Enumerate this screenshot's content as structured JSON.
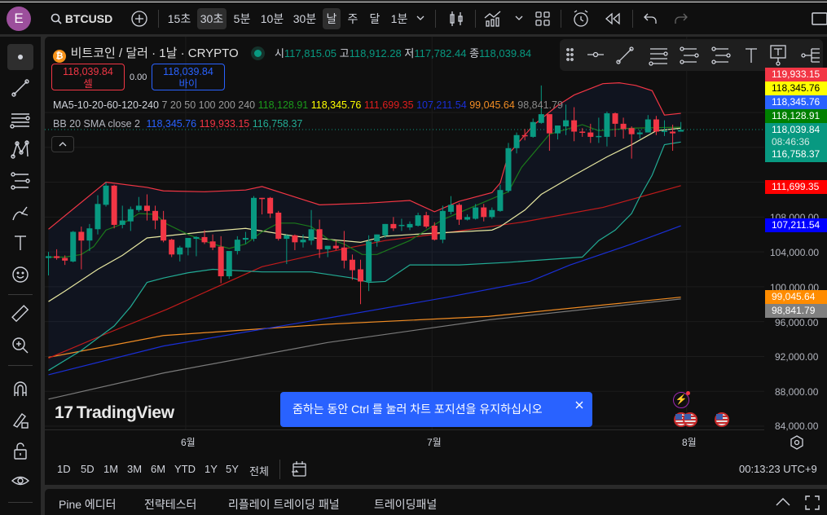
{
  "topbar": {
    "avatar": "E",
    "symbol": "BTCUSD",
    "intervals": [
      "15초",
      "30초",
      "5분",
      "10분",
      "30분",
      "날",
      "주",
      "달",
      "1분"
    ],
    "selected_intervals": [
      "30초",
      "날"
    ]
  },
  "legend": {
    "title": "비트코인 / 달러 · 1날 · CRYPTO",
    "o_label": "시",
    "o": "117,815.05",
    "h_label": "고",
    "h": "118,912.28",
    "l_label": "저",
    "l": "117,782.44",
    "c_label": "종",
    "c": "118,039.84",
    "sell_price": "118,039.84",
    "sell_label": "셀",
    "spread": "0.00",
    "buy_price": "118,039.84",
    "buy_label": "바이",
    "ma_name": "MA5-10-20-60-120-240",
    "ma_params": "7 20 50 100 200 240",
    "ma_values": [
      "118,128.91",
      "118,345.76",
      "111,699.35",
      "107,211.54",
      "99,045.64",
      "98,841.79"
    ],
    "bb_name": "BB 20 SMA close 2",
    "bb_values": [
      "118,345.76",
      "119,933.15",
      "116,758.37"
    ]
  },
  "price_labels": [
    {
      "text": "119,933.15",
      "color": "#f23645"
    },
    {
      "text": "118,345.76",
      "color": "#ffff00"
    },
    {
      "text": "118,345.76",
      "color": "#2962ff"
    },
    {
      "text": "118,128.91",
      "color": "#008000"
    },
    {
      "text": "118,039.84",
      "color": "#089981"
    },
    {
      "text": "08:46:36",
      "color": "#089981"
    },
    {
      "text": "116,758.37",
      "color": "#089981"
    },
    {
      "text": "111,699.35",
      "color": "#ff0000"
    },
    {
      "text": "107,211.54",
      "color": "#0000ff"
    },
    {
      "text": "99,045.64",
      "color": "#ff8c00"
    },
    {
      "text": "98,841.79",
      "color": "#808080"
    }
  ],
  "price_ticks": [
    "108,000.00",
    "104,000.00",
    "100,000.00",
    "96,000.00",
    "92,000.00",
    "88,000.00",
    "84,000.00"
  ],
  "time_ticks": [
    "6월",
    "7월",
    "8월"
  ],
  "toast": {
    "text": "줌하는 동안 Ctrl 를 눌러 차트 포지션을 유지하십시오"
  },
  "logo": "TradingView",
  "ranges": [
    "1D",
    "5D",
    "1M",
    "3M",
    "6M",
    "YTD",
    "1Y",
    "5Y",
    "전체"
  ],
  "clock": "00:13:23 UTC+9",
  "panel_tabs": [
    "Pine 에디터",
    "전략테스터",
    "리플레이 트레이딩 패널",
    "트레이딩패널"
  ],
  "colors": {
    "up": "#089981",
    "down": "#f23645",
    "bb_upper": "#f23645",
    "bb_lower": "#22ab94",
    "bb_basis": "#e6e6a0",
    "ma_short": "#1b7a1b",
    "ma60": "#c21b1b",
    "ma120": "#1a2fd6",
    "ma200": "#f08c24",
    "ma240": "#7a7a7a"
  },
  "chart_data": {
    "type": "candlestick",
    "unit": "thousand USD",
    "ylim": [
      84,
      124
    ],
    "x_ticks": {
      "6월": 17,
      "7월": 47,
      "8월": 78
    },
    "candles": [
      [
        103.3,
        104.0,
        101.3,
        103.5
      ],
      [
        103.5,
        104.3,
        103.1,
        103.3
      ],
      [
        103.3,
        103.6,
        102.5,
        103.0
      ],
      [
        102.9,
        106.4,
        102.8,
        106.3
      ],
      [
        106.3,
        106.9,
        102.0,
        105.3
      ],
      [
        105.3,
        107.2,
        104.1,
        106.7
      ],
      [
        106.6,
        110.5,
        106.0,
        109.5
      ],
      [
        109.4,
        112.0,
        109.2,
        111.6
      ],
      [
        111.6,
        111.7,
        106.7,
        107.1
      ],
      [
        107.1,
        109.3,
        106.7,
        107.6
      ],
      [
        107.5,
        109.2,
        106.4,
        108.9
      ],
      [
        108.8,
        110.3,
        108.6,
        109.3
      ],
      [
        109.3,
        110.6,
        107.6,
        108.7
      ],
      [
        108.7,
        109.3,
        106.6,
        107.6
      ],
      [
        107.7,
        108.7,
        105.1,
        105.3
      ],
      [
        105.4,
        105.5,
        103.4,
        103.7
      ],
      [
        103.7,
        104.7,
        102.9,
        104.5
      ],
      [
        104.5,
        105.6,
        103.6,
        105.6
      ],
      [
        105.5,
        105.8,
        103.5,
        105.7
      ],
      [
        105.7,
        106.5,
        104.9,
        105.1
      ],
      [
        105.2,
        106.0,
        104.2,
        104.5
      ],
      [
        104.6,
        105.8,
        100.4,
        101.2
      ],
      [
        101.2,
        104.1,
        100.9,
        104.1
      ],
      [
        104.1,
        105.8,
        103.7,
        105.4
      ],
      [
        105.4,
        106.3,
        104.9,
        105.6
      ],
      [
        105.5,
        110.4,
        105.2,
        110.2
      ],
      [
        110.2,
        110.2,
        108.3,
        110.1
      ],
      [
        110.2,
        110.3,
        107.9,
        108.4
      ],
      [
        108.5,
        108.7,
        105.3,
        105.5
      ],
      [
        105.5,
        106.0,
        102.6,
        105.9
      ],
      [
        105.9,
        106.0,
        104.2,
        105.1
      ],
      [
        105.1,
        106.0,
        104.5,
        105.4
      ],
      [
        105.3,
        108.8,
        104.8,
        106.6
      ],
      [
        106.6,
        107.7,
        103.3,
        104.3
      ],
      [
        104.3,
        104.7,
        103.4,
        104.7
      ],
      [
        104.7,
        105.3,
        104.2,
        104.4
      ],
      [
        104.5,
        106.4,
        102.1,
        103.0
      ],
      [
        103.1,
        103.7,
        100.8,
        101.9
      ],
      [
        102.0,
        103.1,
        98.0,
        100.6
      ],
      [
        100.6,
        105.9,
        99.5,
        105.2
      ],
      [
        105.2,
        106.0,
        104.6,
        106.0
      ],
      [
        105.9,
        107.2,
        105.6,
        107.2
      ],
      [
        107.2,
        108.0,
        106.4,
        106.7
      ],
      [
        107.0,
        107.8,
        106.4,
        107.1
      ],
      [
        106.8,
        107.5,
        106.5,
        107.2
      ],
      [
        107.0,
        108.5,
        106.9,
        108.2
      ],
      [
        108.2,
        108.6,
        106.7,
        106.9
      ],
      [
        107.0,
        107.4,
        105.3,
        105.4
      ],
      [
        105.4,
        109.3,
        105.0,
        108.7
      ],
      [
        108.6,
        110.4,
        108.3,
        109.4
      ],
      [
        109.4,
        109.6,
        107.1,
        107.7
      ],
      [
        107.7,
        108.3,
        107.6,
        108.0
      ],
      [
        107.8,
        109.5,
        107.7,
        109.1
      ],
      [
        109.1,
        109.5,
        107.5,
        108.0
      ],
      [
        108.0,
        109.1,
        107.8,
        108.8
      ],
      [
        108.7,
        111.7,
        108.6,
        111.1
      ],
      [
        111.0,
        116.5,
        110.8,
        115.9
      ],
      [
        115.9,
        117.7,
        115.3,
        117.4
      ],
      [
        117.4,
        118.1,
        116.8,
        117.3
      ],
      [
        117.2,
        119.3,
        117.1,
        118.9
      ],
      [
        118.8,
        123.1,
        118.7,
        119.8
      ],
      [
        119.8,
        119.8,
        115.6,
        117.6
      ],
      [
        117.6,
        118.5,
        116.9,
        118.5
      ],
      [
        118.4,
        120.9,
        117.4,
        119.1
      ],
      [
        119.1,
        120.6,
        116.7,
        117.8
      ],
      [
        117.8,
        118.2,
        117.2,
        117.7
      ],
      [
        117.7,
        118.7,
        116.5,
        117.2
      ],
      [
        117.2,
        119.4,
        116.5,
        117.3
      ],
      [
        117.2,
        120.1,
        116.1,
        119.9
      ],
      [
        119.9,
        120.0,
        117.2,
        118.7
      ],
      [
        118.7,
        119.4,
        117.0,
        118.1
      ],
      [
        118.2,
        118.4,
        114.7,
        117.5
      ],
      [
        117.5,
        118.0,
        117.0,
        117.7
      ],
      [
        117.7,
        119.7,
        117.7,
        119.2
      ],
      [
        119.2,
        119.6,
        117.4,
        117.8
      ],
      [
        117.8,
        119.1,
        117.3,
        117.9
      ],
      [
        117.8,
        118.6,
        115.6,
        117.6
      ],
      [
        117.8,
        118.9,
        117.8,
        118.0
      ]
    ],
    "lines": {
      "bb_upper": [
        [
          0,
          106.6
        ],
        [
          7,
          112.0
        ],
        [
          12,
          111.4
        ],
        [
          14,
          111.0
        ],
        [
          19,
          110.9
        ],
        [
          24,
          111.1
        ],
        [
          26,
          111.5
        ],
        [
          28,
          110.9
        ],
        [
          33,
          109.4
        ],
        [
          39,
          109.6
        ],
        [
          44,
          109.9
        ],
        [
          47,
          108.6
        ],
        [
          50,
          109.8
        ],
        [
          54,
          110.8
        ],
        [
          55,
          111.9
        ],
        [
          56,
          115.2
        ],
        [
          59,
          118.5
        ],
        [
          62,
          120.8
        ],
        [
          64,
          122.0
        ],
        [
          67.5,
          123.3
        ],
        [
          69.5,
          123.4
        ],
        [
          71.5,
          123.1
        ],
        [
          73.5,
          122.5
        ],
        [
          75,
          119.7
        ],
        [
          77,
          119.9
        ]
      ],
      "bb_lower": [
        [
          0,
          90.4
        ],
        [
          4,
          92.7
        ],
        [
          8,
          95.5
        ],
        [
          10,
          97.7
        ],
        [
          12,
          100.5
        ],
        [
          14,
          101.0
        ],
        [
          17,
          101.6
        ],
        [
          20,
          102.0
        ],
        [
          26,
          101.7
        ],
        [
          32,
          101.7
        ],
        [
          37,
          101.0
        ],
        [
          39,
          100.5
        ],
        [
          41,
          100.6
        ],
        [
          44,
          102.5
        ],
        [
          50,
          102.5
        ],
        [
          56,
          102.8
        ],
        [
          62,
          103.2
        ],
        [
          65,
          103.4
        ],
        [
          67,
          105.3
        ],
        [
          69,
          106.5
        ],
        [
          71,
          108.4
        ],
        [
          72,
          110.3
        ],
        [
          73.5,
          112.8
        ],
        [
          75,
          116.3
        ],
        [
          77,
          116.6
        ]
      ],
      "bb_basis": [
        [
          0,
          98.3
        ],
        [
          2,
          99.5
        ],
        [
          6,
          102.0
        ],
        [
          9,
          103.6
        ],
        [
          12,
          105.6
        ],
        [
          19,
          106.3
        ],
        [
          24,
          106.7
        ],
        [
          30,
          105.8
        ],
        [
          38,
          105.1
        ],
        [
          41,
          105.8
        ],
        [
          46,
          106.1
        ],
        [
          54,
          106.5
        ],
        [
          55,
          106.9
        ],
        [
          58,
          108.8
        ],
        [
          60,
          110.6
        ],
        [
          64,
          112.8
        ],
        [
          68,
          114.9
        ],
        [
          71,
          116.3
        ],
        [
          74,
          117.9
        ],
        [
          77,
          118.2
        ]
      ],
      "ma_short": [
        [
          0,
          103.4
        ],
        [
          2,
          103.4
        ],
        [
          4,
          103.7
        ],
        [
          5.5,
          104.6
        ],
        [
          7,
          106.5
        ],
        [
          9,
          107.2
        ],
        [
          11,
          108.4
        ],
        [
          13,
          108.3
        ],
        [
          14.4,
          107.2
        ],
        [
          17,
          106.0
        ],
        [
          20,
          104.9
        ],
        [
          22,
          104.4
        ],
        [
          24,
          104.9
        ],
        [
          26,
          106.3
        ],
        [
          28,
          107.3
        ],
        [
          30,
          107.3
        ],
        [
          32,
          106.9
        ],
        [
          34,
          105.5
        ],
        [
          36,
          104.9
        ],
        [
          38.2,
          103.7
        ],
        [
          40,
          103.7
        ],
        [
          44,
          105.3
        ],
        [
          48,
          107.7
        ],
        [
          56,
          110.9
        ],
        [
          57.6,
          113.7
        ],
        [
          61,
          117.5
        ],
        [
          65,
          118.6
        ],
        [
          67,
          117.9
        ],
        [
          71,
          118.2
        ],
        [
          77,
          118.3
        ]
      ],
      "ma60": [
        [
          0,
          91.8
        ],
        [
          7,
          94.6
        ],
        [
          14.4,
          97.4
        ],
        [
          26,
          102.3
        ],
        [
          32.6,
          103.7
        ],
        [
          41,
          105.3
        ],
        [
          47.7,
          106.1
        ],
        [
          57.6,
          107.4
        ],
        [
          67.5,
          109.1
        ],
        [
          77,
          111.6
        ]
      ],
      "ma120": [
        [
          0,
          89.9
        ],
        [
          14,
          93.2
        ],
        [
          34,
          96.4
        ],
        [
          48.6,
          98.8
        ],
        [
          58.6,
          100.6
        ],
        [
          63.5,
          102.5
        ],
        [
          71,
          104.9
        ],
        [
          77,
          107.0
        ]
      ],
      "ma200": [
        [
          0,
          91.9
        ],
        [
          14,
          94.4
        ],
        [
          34,
          95.7
        ],
        [
          53.6,
          96.6
        ],
        [
          77,
          98.8
        ]
      ],
      "ma240": [
        [
          0,
          87.1
        ],
        [
          14,
          90.1
        ],
        [
          34,
          93.6
        ],
        [
          53.6,
          96.2
        ],
        [
          77,
          98.6
        ]
      ]
    },
    "last_price": 118.04
  }
}
